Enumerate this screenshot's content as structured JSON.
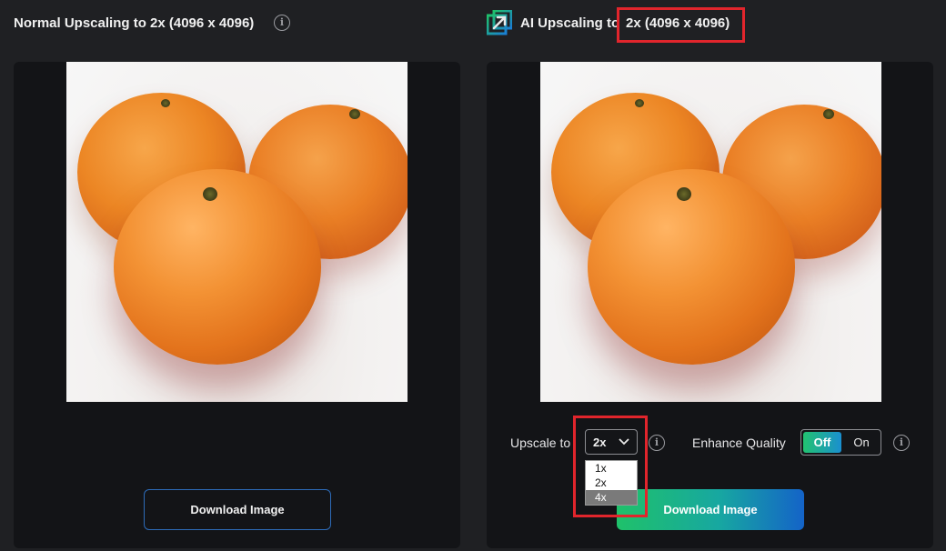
{
  "left": {
    "title": "Normal Upscaling to 2x (4096 x 4096)",
    "info_icon": "i",
    "download_label": "Download Image"
  },
  "right": {
    "logo_icon": "upscale-logo-icon",
    "title_prefix": "AI Upscaling to",
    "title_size": "2x (4096 x 4096)",
    "upscale_label": "Upscale to",
    "upscale_selected": "2x",
    "upscale_options": [
      "1x",
      "2x",
      "4x"
    ],
    "upscale_highlighted": "4x",
    "enhance_label": "Enhance Quality",
    "toggle_off": "Off",
    "toggle_on": "On",
    "info_icon": "i",
    "download_label": "Download Image"
  },
  "colors": {
    "background": "#1f2023",
    "panel": "#131417",
    "annotation_red": "#e1252c",
    "accent_green": "#1fc16a",
    "accent_blue": "#1463c8"
  }
}
